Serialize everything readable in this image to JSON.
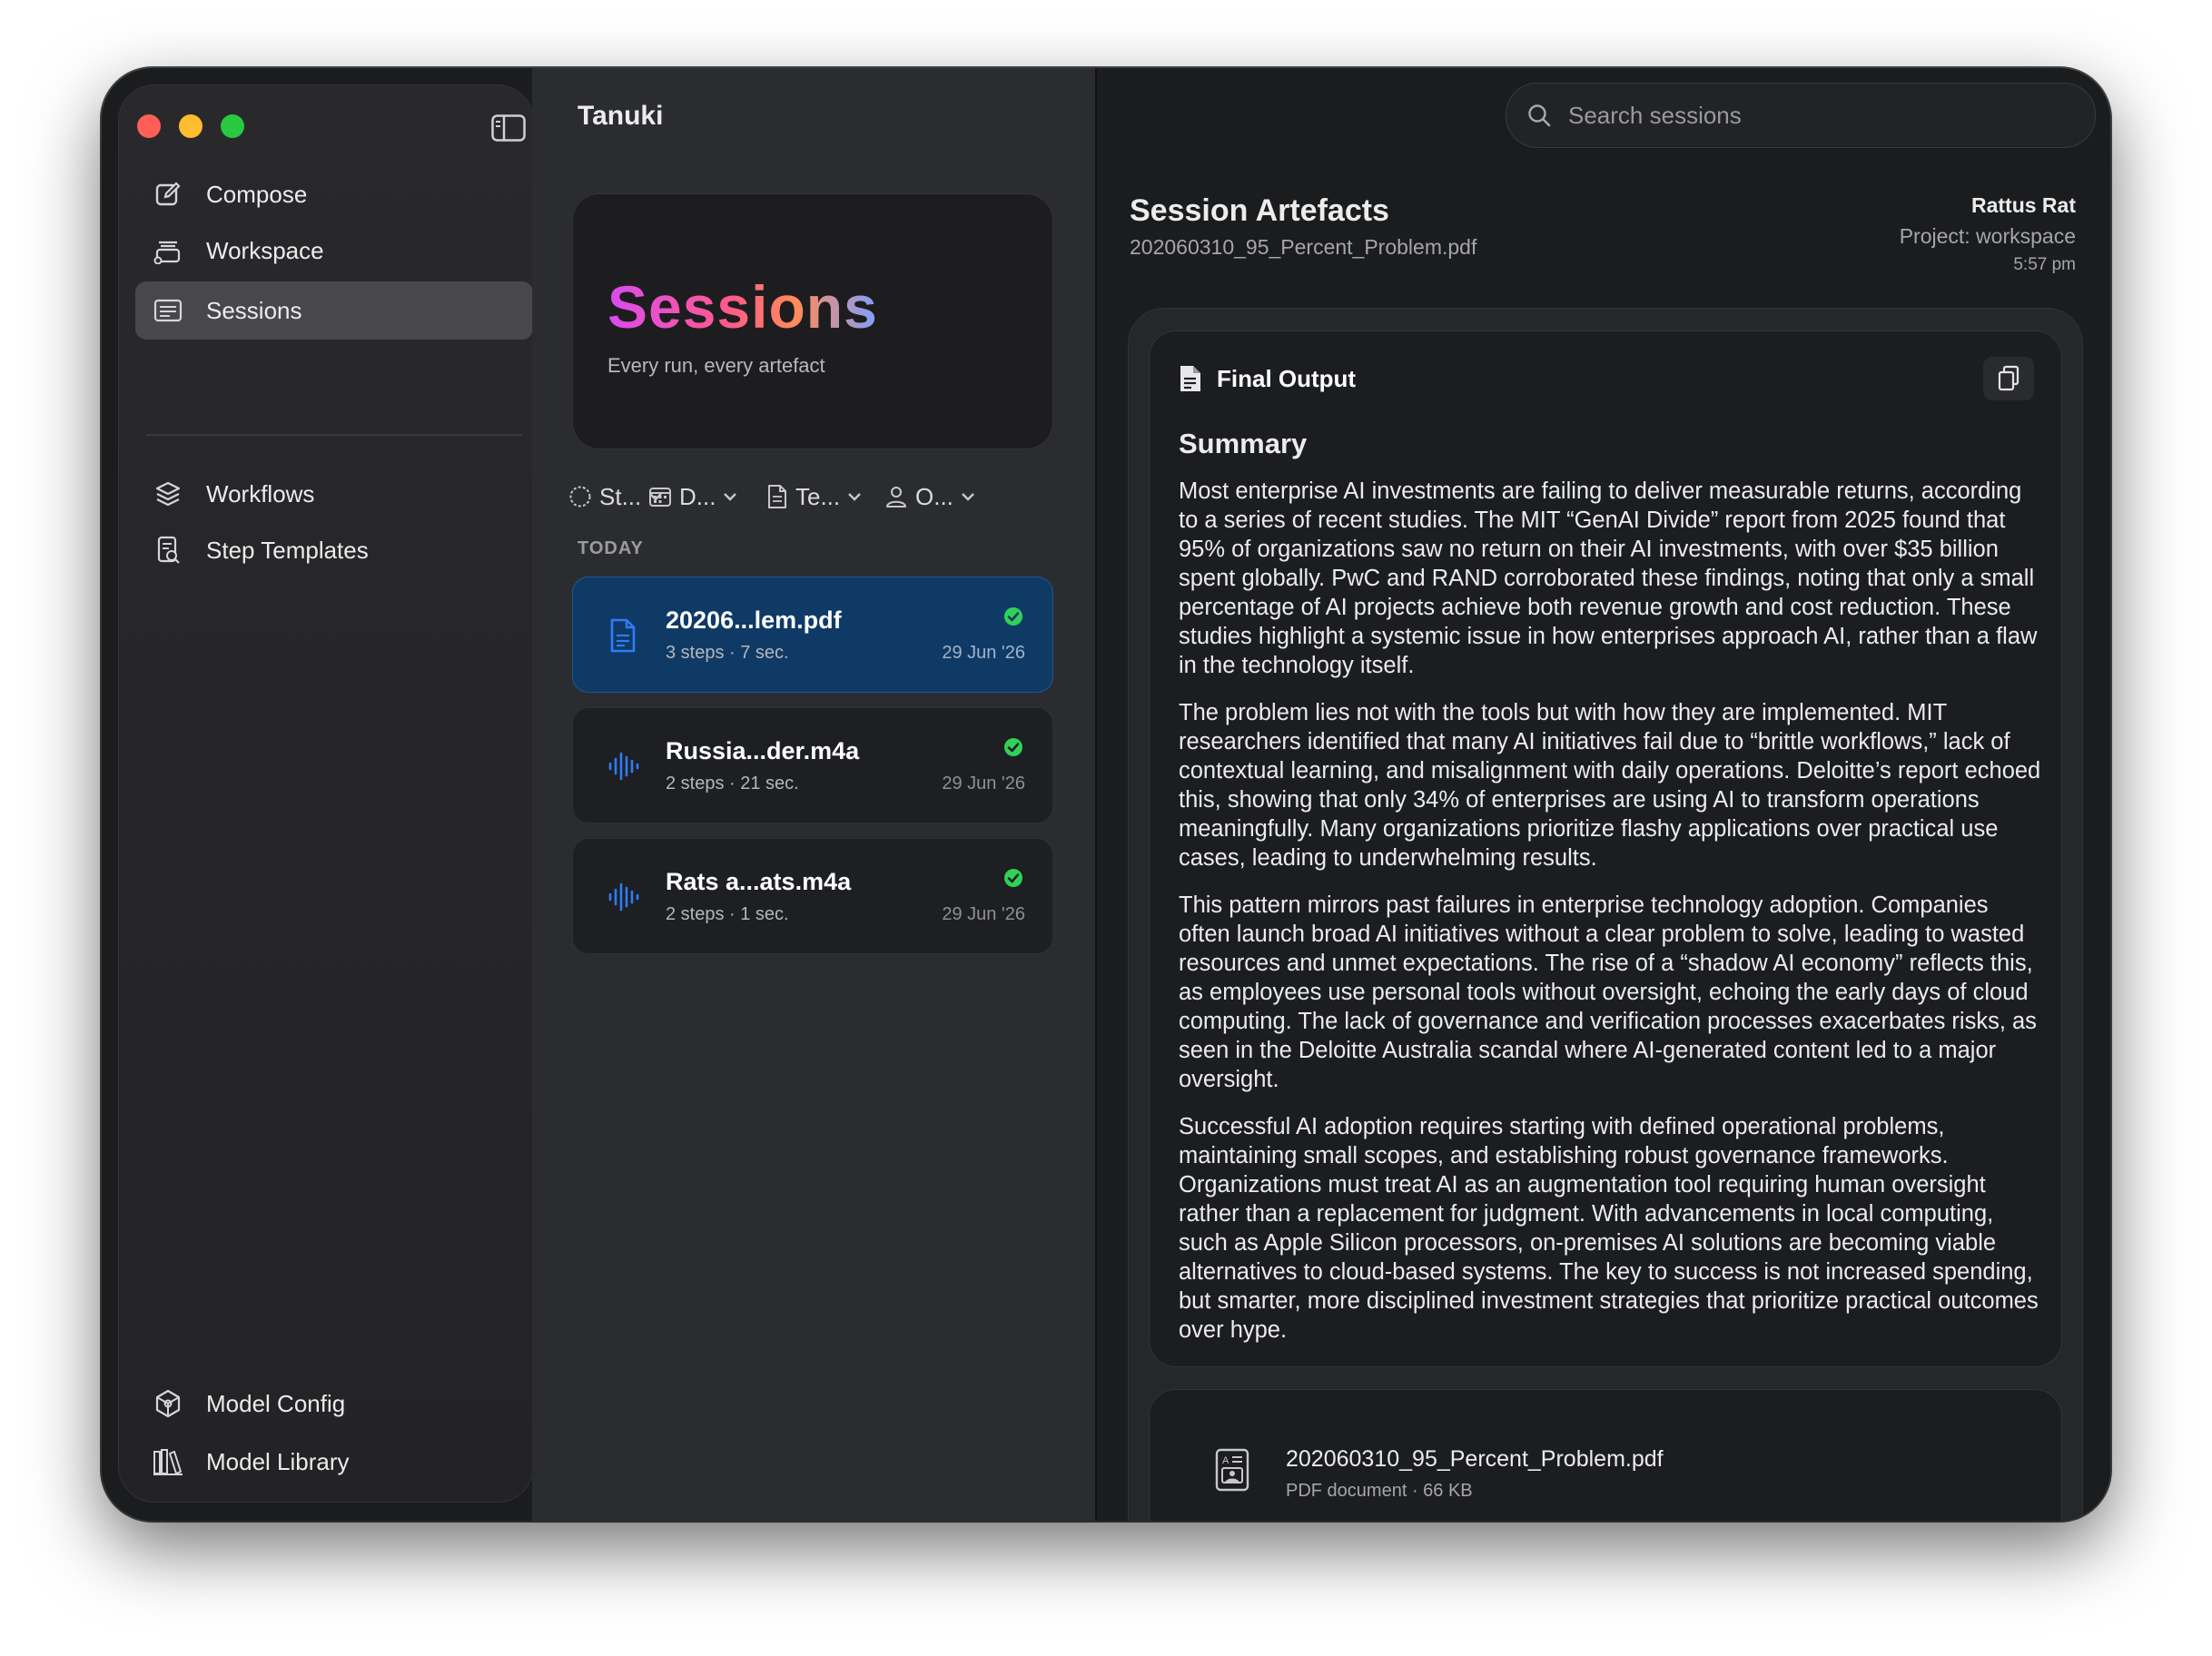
{
  "app": {
    "title": "Tanuki"
  },
  "sidebar": {
    "items": [
      {
        "label": "Compose",
        "icon": "compose-icon"
      },
      {
        "label": "Workspace",
        "icon": "workspace-icon"
      },
      {
        "label": "Sessions",
        "icon": "sessions-icon",
        "active": true
      },
      {
        "label": "Workflows",
        "icon": "workflows-icon"
      },
      {
        "label": "Step Templates",
        "icon": "step-templates-icon"
      }
    ],
    "bottom_items": [
      {
        "label": "Model Config",
        "icon": "model-config-icon"
      },
      {
        "label": "Model Library",
        "icon": "model-library-icon"
      }
    ]
  },
  "hero": {
    "title": "Sessions",
    "subtitle": "Every run, every artefact"
  },
  "filters": [
    {
      "label": "St...",
      "icon": "status-icon"
    },
    {
      "label": "D...",
      "icon": "calendar-icon"
    },
    {
      "label": "Te...",
      "icon": "document-icon"
    },
    {
      "label": "O...",
      "icon": "person-icon"
    }
  ],
  "sessions": {
    "section_label": "TODAY",
    "items": [
      {
        "name": "20206...lem.pdf",
        "meta": "3 steps · 7 sec.",
        "date": "29 Jun '26",
        "type": "pdf",
        "status": "complete",
        "selected": true
      },
      {
        "name": "Russia...der.m4a",
        "meta": "2 steps · 21 sec.",
        "date": "29 Jun '26",
        "type": "audio",
        "status": "complete",
        "selected": false
      },
      {
        "name": "Rats a...ats.m4a",
        "meta": "2 steps · 1 sec.",
        "date": "29 Jun '26",
        "type": "audio",
        "status": "complete",
        "selected": false
      }
    ]
  },
  "search": {
    "placeholder": "Search sessions",
    "value": ""
  },
  "detail": {
    "title": "Session Artefacts",
    "file": "202060310_95_Percent_Problem.pdf",
    "user": "Rattus Rat",
    "project": "Project: workspace",
    "time": "5:57 pm",
    "output": {
      "heading": "Final Output",
      "summary_heading": "Summary",
      "paragraphs": [
        "Most enterprise AI investments are failing to deliver measurable returns, according to a series of recent studies. The MIT “GenAI Divide” report from 2025 found that 95% of organizations saw no return on their AI investments, with over $35 billion spent globally. PwC and RAND corroborated these findings, noting that only a small percentage of AI projects achieve both revenue growth and cost reduction. These studies highlight a systemic issue in how enterprises approach AI, rather than a flaw in the technology itself.",
        "The problem lies not with the tools but with how they are implemented. MIT researchers identified that many AI initiatives fail due to “brittle workflows,” lack of contextual learning, and misalignment with daily operations. Deloitte’s report echoed this, showing that only 34% of enterprises are using AI to transform operations meaningfully. Many organizations prioritize flashy applications over practical use cases, leading to underwhelming results.",
        "This pattern mirrors past failures in enterprise technology adoption. Companies often launch broad AI initiatives without a clear problem to solve, leading to wasted resources and unmet expectations. The rise of a “shadow AI economy” reflects this, as employees use personal tools without oversight, echoing the early days of cloud computing. The lack of governance and verification processes exacerbates risks, as seen in the Deloitte Australia scandal where AI-generated content led to a major oversight.",
        "Successful AI adoption requires starting with defined operational problems, maintaining small scopes, and establishing robust governance frameworks. Organizations must treat AI as an augmentation tool requiring human oversight rather than a replacement for judgment. With advancements in local computing, such as Apple Silicon processors, on-premises AI solutions are becoming viable alternatives to cloud-based systems. The key to success is not increased spending, but smarter, more disciplined investment strategies that prioritize practical outcomes over hype."
      ]
    },
    "attachment": {
      "name": "202060310_95_Percent_Problem.pdf",
      "meta": "PDF document · 66 KB",
      "icon": "pdf-file-icon"
    }
  },
  "colors": {
    "accent_selected": "#0f3a66",
    "status_complete": "#30d158",
    "audio_icon": "#2f7cf6"
  }
}
